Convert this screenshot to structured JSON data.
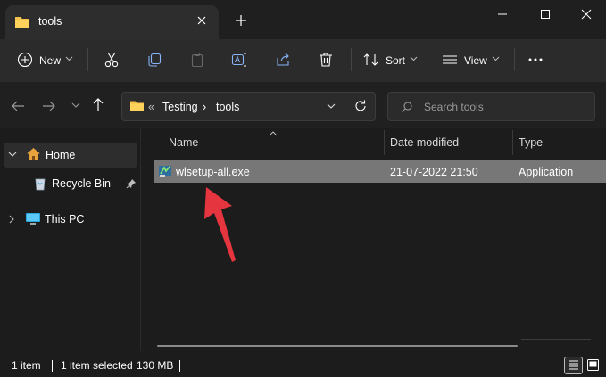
{
  "tab": {
    "title": "tools",
    "folder_icon": "folder-icon",
    "close_icon": "close-icon"
  },
  "new_tab_icon": "plus-icon",
  "window_controls": {
    "minimize": "minimize-icon",
    "maximize": "maximize-icon",
    "close": "close-icon"
  },
  "toolbar": {
    "new_label": "New",
    "sort_label": "Sort",
    "view_label": "View",
    "icons": [
      "cut-icon",
      "copy-icon",
      "paste-icon",
      "rename-icon",
      "share-icon",
      "delete-icon",
      "more-icon"
    ]
  },
  "address": {
    "overflow": "«",
    "crumbs": [
      "Testing",
      "tools"
    ],
    "separator": "›"
  },
  "search": {
    "placeholder": "Search tools"
  },
  "nav": {
    "home": "Home",
    "recycle_bin": "Recycle Bin",
    "this_pc": "This PC"
  },
  "columns": {
    "name": "Name",
    "date": "Date modified",
    "type": "Type"
  },
  "files": [
    {
      "name": "wlsetup-all.exe",
      "date": "21-07-2022 21:50",
      "type": "Application",
      "selected": true
    }
  ],
  "status": {
    "count": "1 item",
    "selection": "1 item selected",
    "size": "130 MB"
  },
  "colors": {
    "accent_arrow": "#e5353f",
    "folder": "#f4c24a",
    "selection": "#777777"
  }
}
